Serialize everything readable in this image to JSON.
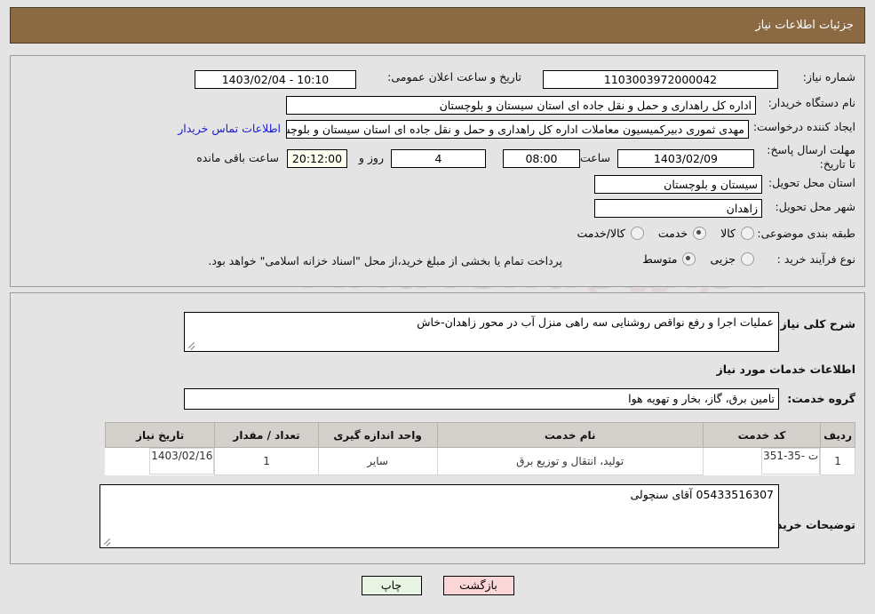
{
  "header": {
    "title": "جزئیات اطلاعات نیاز"
  },
  "watermark": {
    "text": "AriaTender.net"
  },
  "need_info": {
    "need_number_label": "شماره نیاز:",
    "need_number_value": "1103003972000042",
    "announce_datetime_label": "تاریخ و ساعت اعلان عمومی:",
    "announce_datetime_value": "1403/02/04 - 10:10",
    "buyer_org_label": "نام دستگاه خریدار:",
    "buyer_org_value": "اداره کل راهداری و حمل و نقل جاده ای استان سیستان و بلوچستان",
    "creator_label": "ایجاد کننده درخواست:",
    "creator_value": "مهدی ثموری دبیرکمیسیون معاملات اداره کل راهداری و حمل و نقل جاده ای استان سیستان و بلوچستان",
    "contact_link": "اطلاعات تماس خریدار",
    "deadline_label": "مهلت ارسال پاسخ: تا تاریخ:",
    "deadline_date": "1403/02/09",
    "hour_label": "ساعت",
    "deadline_time": "08:00",
    "days_remaining": "4",
    "days_label": "روز و",
    "time_remaining": "20:12:00",
    "time_remaining_label": "ساعت باقی مانده",
    "province_label": "استان محل تحویل:",
    "province_value": "سیستان و بلوچستان",
    "city_label": "شهر محل تحویل:",
    "city_value": "زاهدان",
    "category_label": "طبقه بندی موضوعی:",
    "category_options": [
      {
        "label": "کالا",
        "selected": false
      },
      {
        "label": "خدمت",
        "selected": true
      },
      {
        "label": "کالا/خدمت",
        "selected": false
      }
    ],
    "purchase_type_label": "نوع فرآیند خرید :",
    "purchase_type_options": [
      {
        "label": "جزیی",
        "selected": false
      },
      {
        "label": "متوسط",
        "selected": true
      }
    ],
    "payment_note": "پرداخت تمام یا بخشی از مبلغ خرید،از محل \"اسناد خزانه اسلامی\" خواهد بود."
  },
  "details": {
    "general_desc_label": "شرح کلی نیاز:",
    "general_desc_value": "عملیات اجرا و رفع نواقص روشنایی سه راهی منزل آب در محور زاهدان-خاش",
    "services_section_title": "اطلاعات خدمات مورد نیاز",
    "service_group_label": "گروه خدمت:",
    "service_group_value": "تامین برق، گاز، بخار و تهویه هوا",
    "table": {
      "columns": [
        "ردیف",
        "کد خدمت",
        "نام خدمت",
        "واحد اندازه گیری",
        "تعداد / مقدار",
        "تاریخ نیاز"
      ],
      "rows": [
        {
          "row_no": "1",
          "service_code": "ت -35-351",
          "service_name": "تولید، انتقال و توزیع برق",
          "unit": "سایر",
          "quantity": "1",
          "need_date": "1403/02/16"
        }
      ]
    },
    "buyer_notes_label": "توضیحات خریدار:",
    "buyer_notes_value": "05433516307 آقای سنچولی"
  },
  "footer": {
    "print_label": "چاپ",
    "back_label": "بازگشت"
  },
  "colors": {
    "header_bg": "#8b6a43",
    "link": "#1a1ad0",
    "print_bg": "#e8f5e3",
    "back_bg": "#fbd6d6",
    "countdown_bg": "#fffff0"
  }
}
